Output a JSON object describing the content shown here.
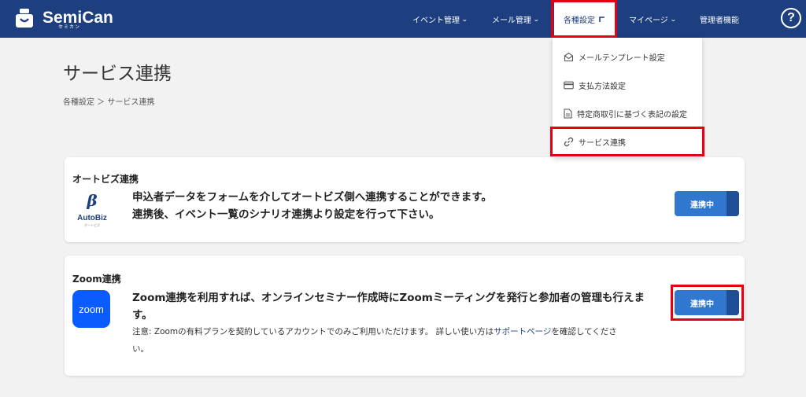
{
  "app": {
    "name": "SemiCan",
    "name_sub": "セミカン"
  },
  "nav": {
    "items": [
      "イベント管理",
      "メール管理",
      "各種設定",
      "マイページ",
      "管理者機能"
    ],
    "help": "?"
  },
  "dropdown": {
    "items": [
      "メールテンプレート設定",
      "支払方法設定",
      "特定商取引に基づく表記の設定",
      "サービス連携"
    ]
  },
  "page": {
    "title": "サービス連携",
    "breadcrumb": "各種設定 ＞ サービス連携"
  },
  "cards": {
    "autobiz": {
      "title": "オートビズ連携",
      "logo_text": "AutoBiz",
      "logo_sub": "オートビズ",
      "desc_line1": "申込者データをフォームを介してオートビズ側へ連携することができます。",
      "desc_line2": "連携後、イベント一覧のシナリオ連携より設定を行って下さい。",
      "button": "連携中"
    },
    "zoom": {
      "title": "Zoom連携",
      "logo_text": "zoom",
      "desc_line1": "Zoom連携を利用すれば、オンラインセミナー作成時にZoomミーティングを発行と参加者の管理も行えま",
      "desc_line2": "す。",
      "note_line1_prefix": "注意: Zoomの有料プランを契約しているアカウントでのみご利用いただけます。 詳しい使い方は",
      "note_link": "サポートページ",
      "note_line1_suffix": "を確認してくださ",
      "note_line2": "い。",
      "button": "連携中"
    }
  },
  "colors": {
    "header": "#1d3f80",
    "button": "#2f77cf",
    "highlight": "#e60012",
    "zoom": "#0b5cff"
  }
}
